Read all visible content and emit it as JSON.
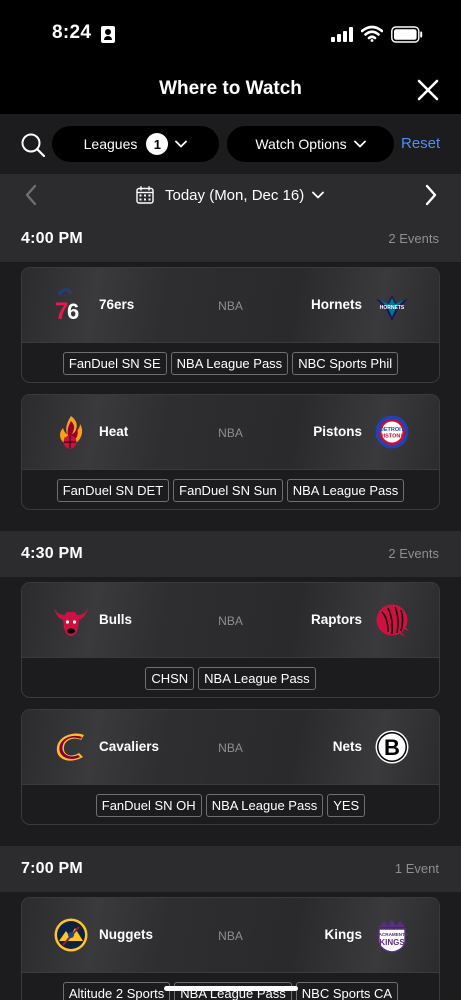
{
  "status_bar": {
    "time": "8:24"
  },
  "header": {
    "title": "Where to Watch"
  },
  "filters": {
    "leagues_label": "Leagues",
    "leagues_count": "1",
    "watch_options_label": "Watch Options",
    "reset_label": "Reset"
  },
  "date_nav": {
    "label": "Today (Mon, Dec 16)"
  },
  "colors": {
    "accent": "#4f8ef7",
    "background": "#1c1c1e",
    "section_header": "#2c2c2e",
    "muted": "#8e8e93"
  },
  "sections": [
    {
      "time": "4:00 PM",
      "count": "2 Events",
      "games": [
        {
          "home": "76ers",
          "home_icon": "76ers-logo-icon",
          "league": "NBA",
          "away": "Hornets",
          "away_icon": "hornets-logo-icon",
          "channels": [
            "FanDuel SN SE",
            "NBA League Pass",
            "NBC Sports Phil"
          ]
        },
        {
          "home": "Heat",
          "home_icon": "heat-logo-icon",
          "league": "NBA",
          "away": "Pistons",
          "away_icon": "pistons-logo-icon",
          "channels": [
            "FanDuel SN DET",
            "FanDuel SN Sun",
            "NBA League Pass"
          ]
        }
      ]
    },
    {
      "time": "4:30 PM",
      "count": "2 Events",
      "games": [
        {
          "home": "Bulls",
          "home_icon": "bulls-logo-icon",
          "league": "NBA",
          "away": "Raptors",
          "away_icon": "raptors-logo-icon",
          "channels": [
            "CHSN",
            "NBA League Pass"
          ]
        },
        {
          "home": "Cavaliers",
          "home_icon": "cavaliers-logo-icon",
          "league": "NBA",
          "away": "Nets",
          "away_icon": "nets-logo-icon",
          "channels": [
            "FanDuel SN OH",
            "NBA League Pass",
            "YES"
          ]
        }
      ]
    },
    {
      "time": "7:00 PM",
      "count": "1 Event",
      "games": [
        {
          "home": "Nuggets",
          "home_icon": "nuggets-logo-icon",
          "league": "NBA",
          "away": "Kings",
          "away_icon": "kings-logo-icon",
          "channels": [
            "Altitude 2 Sports",
            "NBA League Pass",
            "NBC Sports CA"
          ]
        }
      ]
    }
  ]
}
